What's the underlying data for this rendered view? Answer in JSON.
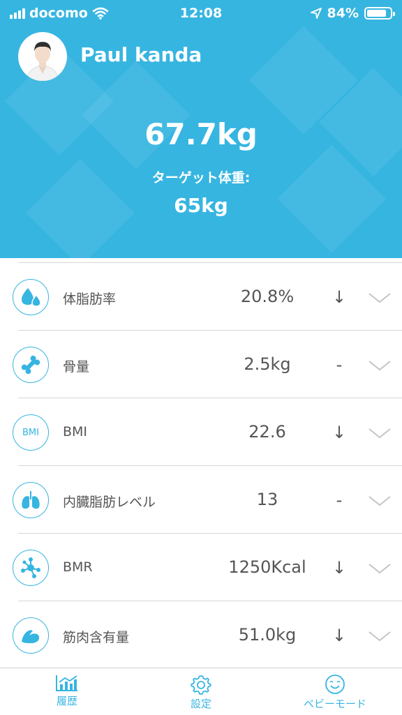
{
  "status_bar": {
    "carrier": "docomo",
    "time": "12:08",
    "battery": "84%",
    "battery_level": 0.84
  },
  "profile": {
    "name": "Paul kanda",
    "weight": "67.7kg",
    "target_label": "ターゲット体重:",
    "target_value": "65kg"
  },
  "metrics": [
    {
      "label": "体脂肪率",
      "value": "20.8%",
      "trend": "↓",
      "icon": "water-drops-icon"
    },
    {
      "label": "骨量",
      "value": "2.5kg",
      "trend": "-",
      "icon": "bone-icon"
    },
    {
      "label": "BMI",
      "value": "22.6",
      "trend": "↓",
      "icon": "bmi-icon",
      "icon_text": "BMI"
    },
    {
      "label": "内臓脂肪レベル",
      "value": "13",
      "trend": "-",
      "icon": "lungs-icon"
    },
    {
      "label": "BMR",
      "value": "1250Kcal",
      "trend": "↓",
      "icon": "molecule-icon"
    },
    {
      "label": "筋肉含有量",
      "value": "51.0kg",
      "trend": "↓",
      "icon": "muscle-arm-icon"
    }
  ],
  "tabs": [
    {
      "label": "履歴",
      "icon": "chart-icon"
    },
    {
      "label": "設定",
      "icon": "gear-icon"
    },
    {
      "label": "ベビーモード",
      "icon": "smiley-icon"
    }
  ],
  "colors": {
    "accent": "#36b5e1",
    "text": "#555555"
  }
}
